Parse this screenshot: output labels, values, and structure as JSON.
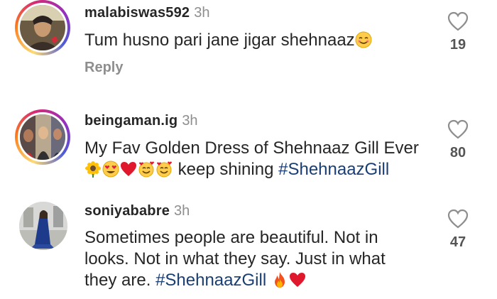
{
  "comments": [
    {
      "username": "malabiswas592",
      "time": "3h",
      "text": "Tum husno pari jane jigar shehnaaz",
      "likes": "19",
      "reply_label": "Reply"
    },
    {
      "username": "beingaman.ig",
      "time": "3h",
      "text_line1": "My Fav Golden Dress of Shehnaaz Gill Ever",
      "text_line2_plain": " keep shining ",
      "hashtag": "#ShehnaazGill",
      "likes": "80"
    },
    {
      "username": "soniyababre",
      "time": "3h",
      "text_line1": "Sometimes people are beautiful. Not in",
      "text_line2": "looks. Not in what they say. Just in what",
      "text_line3_plain": "they are. ",
      "hashtag": "#ShehnaazGill",
      "likes": "47"
    }
  ],
  "icons": {
    "like": "heart-outline-icon",
    "emoji_smile": "smiling-face-emoji",
    "sunflower": "sunflower-emoji",
    "heart_eyes": "heart-eyes-emoji",
    "red_heart": "red-heart-emoji",
    "hearts_face": "smiling-face-with-hearts-emoji",
    "fire": "fire-emoji"
  },
  "colors": {
    "hashtag": "#1a3e72",
    "muted": "#8e8e8e",
    "text": "#262626"
  }
}
